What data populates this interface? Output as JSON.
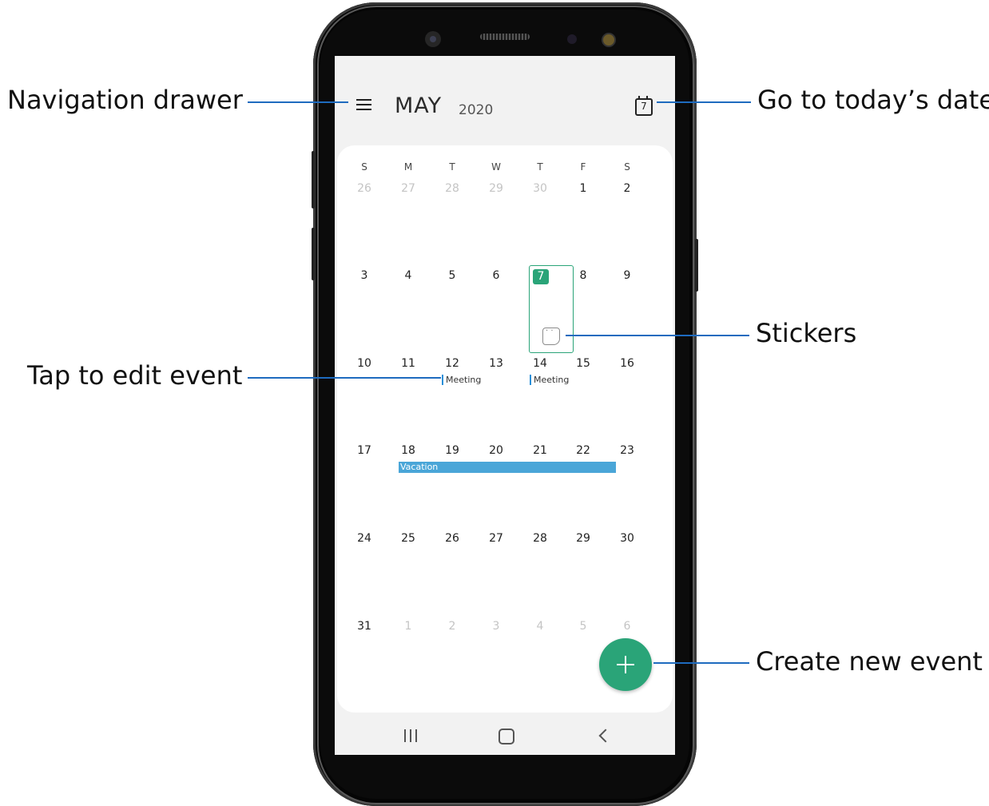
{
  "callouts": {
    "navigation_drawer": "Navigation drawer",
    "go_to_today": "Go to today’s date",
    "stickers": "Stickers",
    "tap_to_edit": "Tap to  edit event",
    "create_new_event": "Create new event"
  },
  "header": {
    "month": "MAY",
    "year": "2020",
    "today_icon_number": "7",
    "menu_icon": "hamburger-menu-icon",
    "today_icon": "calendar-today-icon"
  },
  "calendar": {
    "weekdays": [
      "S",
      "M",
      "T",
      "W",
      "T",
      "F",
      "S"
    ],
    "weeks": [
      [
        "26",
        "27",
        "28",
        "29",
        "30",
        "1",
        "2"
      ],
      [
        "3",
        "4",
        "5",
        "6",
        "7",
        "8",
        "9"
      ],
      [
        "10",
        "11",
        "12",
        "13",
        "14",
        "15",
        "16"
      ],
      [
        "17",
        "18",
        "19",
        "20",
        "21",
        "22",
        "23"
      ],
      [
        "24",
        "25",
        "26",
        "27",
        "28",
        "29",
        "30"
      ],
      [
        "31",
        "1",
        "2",
        "3",
        "4",
        "5",
        "6"
      ]
    ],
    "today": "7",
    "events": {
      "meeting_12": "Meeting",
      "meeting_14": "Meeting",
      "vacation": "Vacation"
    }
  },
  "colors": {
    "accent_green": "#2aa478",
    "event_blue": "#4aa6d8",
    "callout_line": "#1e6bbf"
  },
  "nav": {
    "recent_icon": "recent-apps-icon",
    "home_icon": "home-icon",
    "back_icon": "back-icon"
  }
}
